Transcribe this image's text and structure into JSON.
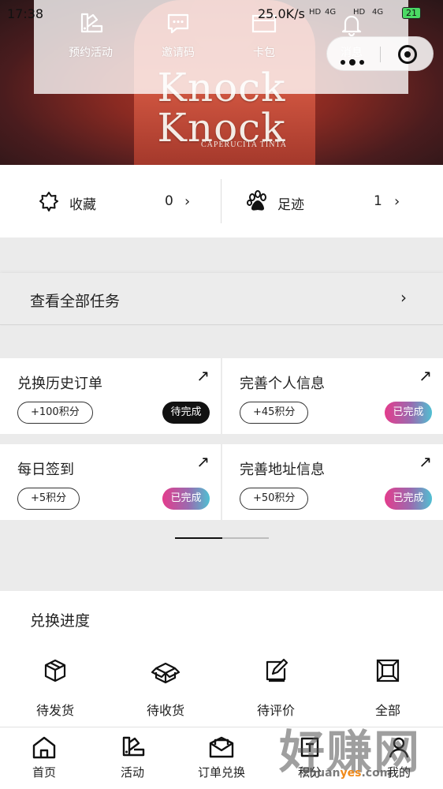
{
  "status_bar": {
    "time": "17:38",
    "speed": "25.0K/s",
    "icons": [
      "HD",
      "4G",
      "HD",
      "4G"
    ],
    "battery": "21"
  },
  "quick_menu": [
    {
      "label": "预约活动",
      "icon": "swatch-icon"
    },
    {
      "label": "邀请码",
      "icon": "chat-bubble-icon"
    },
    {
      "label": "卡包",
      "icon": "card-icon"
    },
    {
      "label": "消息",
      "icon": "bell-icon"
    }
  ],
  "banner": {
    "line1": "Knock",
    "line2": "Knock",
    "tagline": "CAPERUCITA TINTA"
  },
  "stats": {
    "favorites": {
      "label": "收藏",
      "count": "0",
      "icon": "star-icon"
    },
    "footprints": {
      "label": "足迹",
      "count": "1",
      "icon": "paw-icon"
    }
  },
  "tasks": {
    "view_all": "查看全部任务",
    "items": [
      {
        "title": "兑换历史订单",
        "points": "+100积分",
        "status": "待完成"
      },
      {
        "title": "完善个人信息",
        "points": "+45积分",
        "status": "已完成"
      },
      {
        "title": "每日签到",
        "points": "+5积分",
        "status": "已完成"
      },
      {
        "title": "完善地址信息",
        "points": "+50积分",
        "status": "已完成"
      }
    ]
  },
  "progress": {
    "title": "兑换进度",
    "items": [
      {
        "label": "待发货",
        "icon": "box-icon"
      },
      {
        "label": "待收货",
        "icon": "open-box-icon"
      },
      {
        "label": "待评价",
        "icon": "edit-icon"
      },
      {
        "label": "全部",
        "icon": "square-frame-icon"
      }
    ]
  },
  "tabbar": [
    {
      "label": "首页",
      "icon": "home-icon"
    },
    {
      "label": "活动",
      "icon": "swatch-icon"
    },
    {
      "label": "订单兑换",
      "icon": "mail-icon"
    },
    {
      "label": "积分",
      "icon": "points-icon"
    },
    {
      "label": "我的",
      "icon": "profile-icon"
    }
  ],
  "watermark": {
    "big": "好赚网",
    "small_a": "zhuan",
    "small_b": "yes",
    "small_c": ".com"
  },
  "colors": {
    "pending_badge": "#111111",
    "done_badge_start": "#e43c8c",
    "done_badge_end": "#4fc0d2",
    "page_bg": "#ebebeb"
  }
}
